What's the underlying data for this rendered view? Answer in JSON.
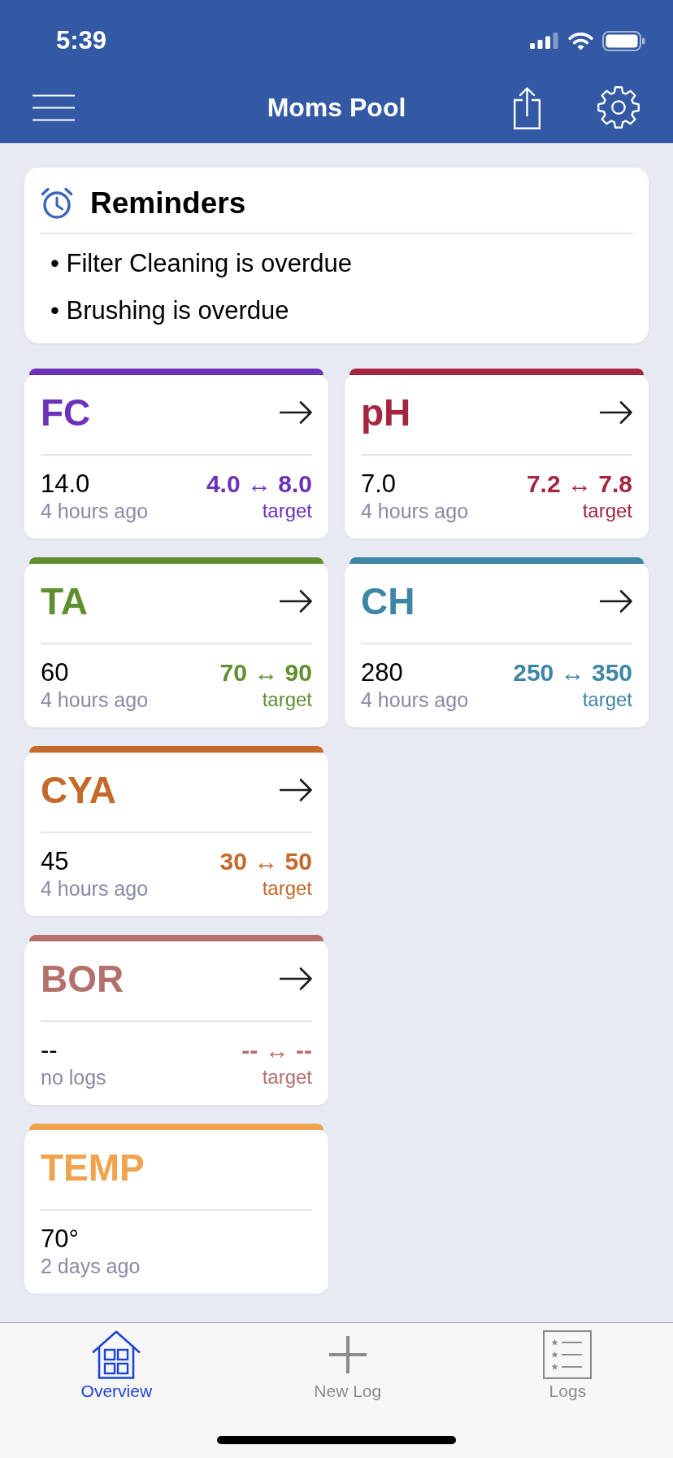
{
  "status_bar": {
    "time": "5:39"
  },
  "nav_bar": {
    "title": "Moms Pool"
  },
  "reminders": {
    "title": "Reminders",
    "items": [
      "• Filter Cleaning is overdue",
      "• Brushing is overdue"
    ]
  },
  "metric_rows": [
    {
      "cards": [
        {
          "kind": "range",
          "name": "FC",
          "color": "#6c30b9",
          "value": "14.0",
          "updated": "4 hours ago",
          "target": "4.0 ↔ 8.0",
          "target_label": "target"
        },
        {
          "kind": "range",
          "name": "pH",
          "color": "#a5253f",
          "value": "7.0",
          "updated": "4 hours ago",
          "target": "7.2 ↔ 7.8",
          "target_label": "target"
        }
      ]
    },
    {
      "cards": [
        {
          "kind": "range",
          "name": "TA",
          "color": "#5f8f31",
          "value": "60",
          "updated": "4 hours ago",
          "target": "70 ↔ 90",
          "target_label": "target"
        },
        {
          "kind": "range",
          "name": "CH",
          "color": "#3d86a5",
          "value": "280",
          "updated": "4 hours ago",
          "target": "250 ↔ 350",
          "target_label": "target"
        }
      ]
    },
    {
      "cards": [
        {
          "kind": "range",
          "name": "CYA",
          "color": "#c4692a",
          "value": "45",
          "updated": "4 hours ago",
          "target": "30 ↔ 50",
          "target_label": "target"
        }
      ]
    },
    {
      "cards": [
        {
          "kind": "range",
          "name": "BOR",
          "color": "#b4706c",
          "value": "--",
          "updated": "no logs",
          "target": "-- ↔ --",
          "target_label": "target"
        }
      ]
    },
    {
      "cards": [
        {
          "kind": "reading",
          "name": "TEMP",
          "color": "#f0a34d",
          "value": "70°",
          "updated": "2 days ago"
        }
      ]
    }
  ],
  "tab_bar": {
    "tabs": [
      {
        "label": "Overview",
        "selected": true
      },
      {
        "label": "New Log",
        "selected": false
      },
      {
        "label": "Logs",
        "selected": false
      }
    ]
  }
}
